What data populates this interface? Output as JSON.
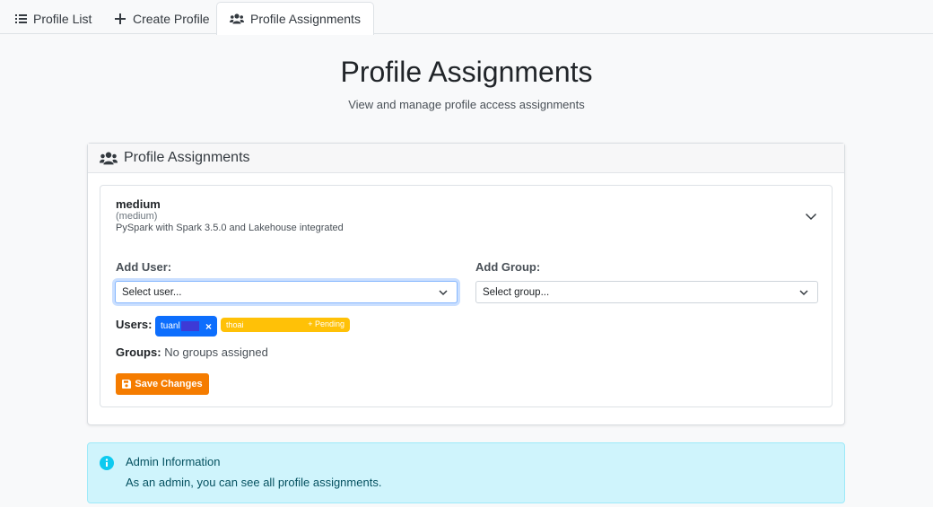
{
  "tabs": [
    {
      "label": "Profile List",
      "icon": "list-icon"
    },
    {
      "label": "Create Profile",
      "icon": "plus-icon"
    },
    {
      "label": "Profile Assignments",
      "icon": "users-icon",
      "active": true
    }
  ],
  "header": {
    "title": "Profile Assignments",
    "subtitle": "View and manage profile access assignments"
  },
  "card": {
    "title": "Profile Assignments",
    "profile": {
      "name": "medium",
      "id": "(medium)",
      "description": "PySpark with Spark 3.5.0 and Lakehouse integrated"
    },
    "add_user": {
      "label": "Add User:",
      "placeholder": "Select user..."
    },
    "add_group": {
      "label": "Add Group:",
      "placeholder": "Select group..."
    },
    "users": {
      "label": "Users:",
      "assigned": [
        {
          "name": "tuanl",
          "remove": "×"
        }
      ],
      "pending": [
        {
          "name": "thoai",
          "status": "+ Pending"
        }
      ]
    },
    "groups": {
      "label": "Groups:",
      "value": "No groups assigned"
    },
    "save_label": "Save Changes"
  },
  "alert": {
    "title": "Admin Information",
    "body": "As an admin, you can see all profile assignments."
  },
  "colors": {
    "primary": "#0d6efd",
    "warning": "#ffc107",
    "save": "#f57c00",
    "info_bg": "#cff4fc",
    "info_icon": "#0dcaf0"
  }
}
